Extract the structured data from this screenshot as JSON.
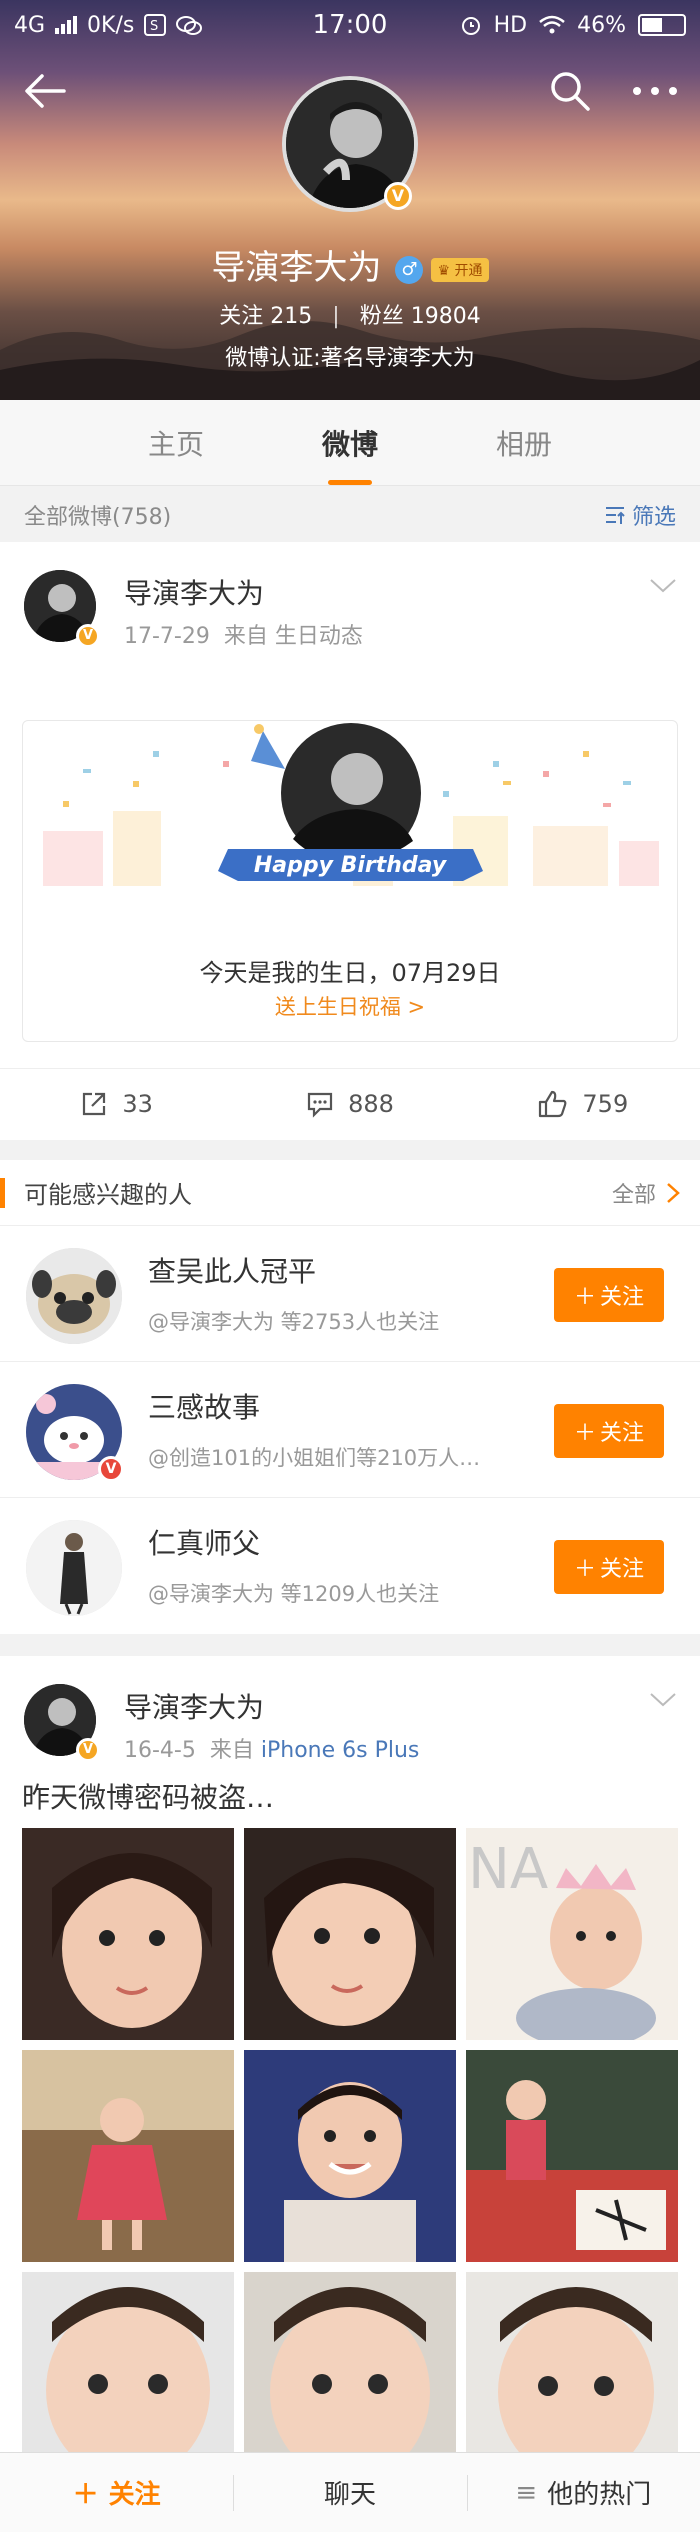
{
  "status_bar": {
    "network": "4G",
    "speed": "0K/s",
    "time": "17:00",
    "hd": "HD",
    "battery": "46%"
  },
  "profile": {
    "name": "导演李大为",
    "vip_label": "开通",
    "following_label": "关注",
    "following_count": "215",
    "followers_label": "粉丝",
    "followers_count": "19804",
    "verification": "微博认证:著名导演李大为"
  },
  "tabs": [
    {
      "label": "主页",
      "active": false
    },
    {
      "label": "微博",
      "active": true
    },
    {
      "label": "相册",
      "active": false
    }
  ],
  "section": {
    "all_posts": "全部微博(758)",
    "filter": "筛选"
  },
  "post1": {
    "author": "导演李大为",
    "date": "17-7-29",
    "source_prefix": "来自",
    "source": "生日动态",
    "banner_text": "Happy Birthday",
    "message": "今天是我的生日，07月29日",
    "send_wish": "送上生日祝福 >",
    "reposts": "33",
    "comments": "888",
    "likes": "759"
  },
  "recommend": {
    "title": "可能感兴趣的人",
    "all_label": "全部",
    "follow_label": "关注",
    "people": [
      {
        "name": "查吴此人冠平",
        "sub": "@导演李大为 等2753人也关注"
      },
      {
        "name": "三感故事",
        "sub": "@创造101的小姐姐们等210万人…"
      },
      {
        "name": "仁真师父",
        "sub": "@导演李大为 等1209人也关注"
      }
    ]
  },
  "post2": {
    "author": "导演李大为",
    "date": "16-4-5",
    "source_prefix": "来自",
    "source": "iPhone 6s Plus",
    "text": "昨天微博密码被盗…"
  },
  "bottom_bar": {
    "follow": "关注",
    "chat": "聊天",
    "hot": "他的热门"
  },
  "colors": {
    "accent": "#ff8200",
    "link_blue": "#4a78b8",
    "verified": "#f5a623"
  }
}
